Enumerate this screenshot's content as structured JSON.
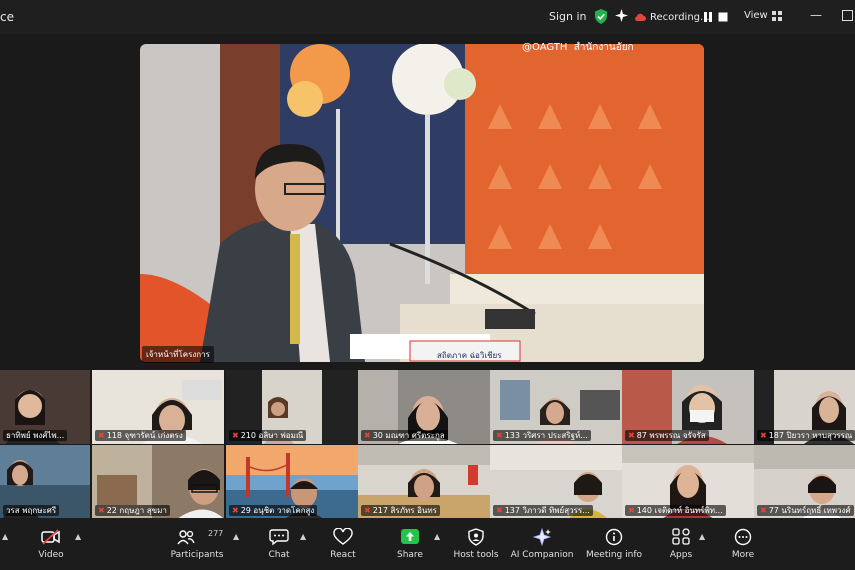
{
  "titlebar": {
    "app_title": "ce",
    "sign_in": "Sign in",
    "recording": "Recording...",
    "view": "View"
  },
  "speaker": {
    "label": "เจ้าหน้าที่โครงการ",
    "social_handle": "@OAGTH",
    "office_text": "สำนักงานอัยก",
    "nameplate": "สถิตภาค ฉ่อวิเชียร"
  },
  "gallery": [
    {
      "name": "ธาทิพย์ พงศ์ไพ...",
      "muted": false
    },
    {
      "name": "118 จุฑารัตน์ เก่งตรง",
      "muted": true
    },
    {
      "name": "210 อลิษา พ่อมณี",
      "muted": true
    },
    {
      "name": "30 มณฑา ศรีตระกูล",
      "muted": true
    },
    {
      "name": "133 วริศรา ประสริฐห์...",
      "muted": true
    },
    {
      "name": "87 พรพรรณ จรัจรัส",
      "muted": true
    },
    {
      "name": "187 ปิยวรา หาบสุวรรณ",
      "muted": true
    },
    {
      "name": "วรส พฤกษะศรี",
      "muted": false
    },
    {
      "name": "22 กฤษฎา สุขมา",
      "muted": true
    },
    {
      "name": "29 อนุชิต วาดโคกสูง",
      "muted": true
    },
    {
      "name": "217 สิรภัทร อินทร",
      "muted": true
    },
    {
      "name": "137 วิภาวดี ทิพย์สุวรร...",
      "muted": true
    },
    {
      "name": "140 เจติดาห์ อินทร์พิท...",
      "muted": true
    },
    {
      "name": "77 นรินทร์ฤทธิ์ เทพวงศ์",
      "muted": true
    }
  ],
  "toolbar": {
    "video": "Video",
    "participants": "Participants",
    "participants_count": "277",
    "chat": "Chat",
    "react": "React",
    "share": "Share",
    "host_tools": "Host tools",
    "ai_companion": "AI Companion",
    "meeting_info": "Meeting info",
    "apps": "Apps",
    "more": "More"
  },
  "colors": {
    "share_green": "#26c34a",
    "recording_red": "#e3453b",
    "shield_green": "#23b14d"
  }
}
